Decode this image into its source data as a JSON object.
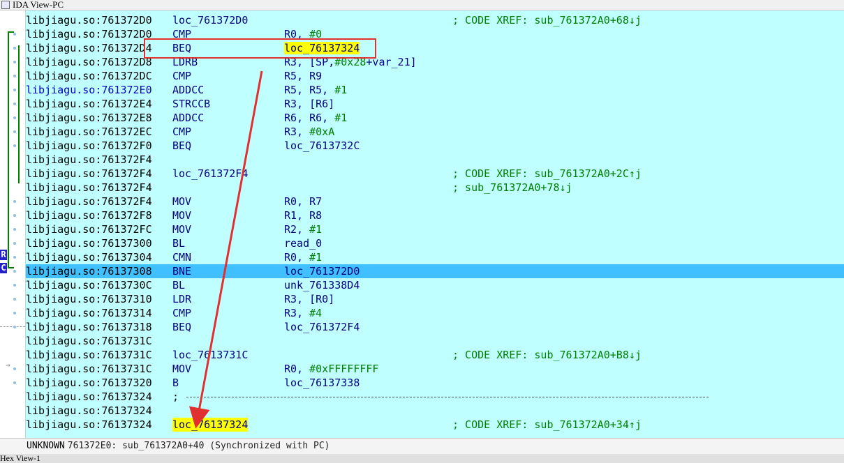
{
  "window": {
    "title": "IDA View-PC",
    "bottom_tab": "Hex View-1"
  },
  "gutter": {
    "pc_label_1": "R",
    "pc_label_2": "C"
  },
  "lines": [
    {
      "addr": "libjiagu.so:761372D0",
      "label": "loc_761372D0",
      "cmt": "; CODE XREF: sub_761372A0+68↓j"
    },
    {
      "addr": "libjiagu.so:761372D0",
      "mnem": "CMP",
      "ops": "R0, ",
      "num": "#0"
    },
    {
      "addr": "libjiagu.so:761372D4",
      "mnem": "BEQ",
      "ops": "",
      "target": "loc_76137324"
    },
    {
      "addr": "libjiagu.so:761372D8",
      "mnem": "LDRB",
      "ops": "R3, [SP,",
      "num": "#0x28",
      "ops2": "+var_21]"
    },
    {
      "addr": "libjiagu.so:761372DC",
      "mnem": "CMP",
      "ops": "R5, R9"
    },
    {
      "addr": "libjiagu.so:761372E0",
      "mnem": "ADDCC",
      "ops": "R5, R5, ",
      "num": "#1",
      "blue": true
    },
    {
      "addr": "libjiagu.so:761372E4",
      "mnem": "STRCCB",
      "ops": "R3, [R6]"
    },
    {
      "addr": "libjiagu.so:761372E8",
      "mnem": "ADDCC",
      "ops": "R6, R6, ",
      "num": "#1"
    },
    {
      "addr": "libjiagu.so:761372EC",
      "mnem": "CMP",
      "ops": "R3, ",
      "num": "#0xA"
    },
    {
      "addr": "libjiagu.so:761372F0",
      "mnem": "BEQ",
      "ops": "loc_7613732C"
    },
    {
      "addr": "libjiagu.so:761372F4"
    },
    {
      "addr": "libjiagu.so:761372F4",
      "label": "loc_761372F4",
      "cmt": "; CODE XREF: sub_761372A0+2C↑j"
    },
    {
      "addr": "libjiagu.so:761372F4",
      "cmt": "; sub_761372A0+78↓j"
    },
    {
      "addr": "libjiagu.so:761372F4",
      "mnem": "MOV",
      "ops": "R0, R7"
    },
    {
      "addr": "libjiagu.so:761372F8",
      "mnem": "MOV",
      "ops": "R1, R8"
    },
    {
      "addr": "libjiagu.so:761372FC",
      "mnem": "MOV",
      "ops": "R2, ",
      "num": "#1"
    },
    {
      "addr": "libjiagu.so:76137300",
      "mnem": "BL",
      "ops": "read_0"
    },
    {
      "addr": "libjiagu.so:76137304",
      "mnem": "CMN",
      "ops": "R0, ",
      "num": "#1"
    },
    {
      "addr": "libjiagu.so:76137308",
      "mnem": "BNE",
      "ops": "loc_761372D0",
      "highlight": true
    },
    {
      "addr": "libjiagu.so:7613730C",
      "mnem": "BL",
      "ops": "unk_761338D4"
    },
    {
      "addr": "libjiagu.so:76137310",
      "mnem": "LDR",
      "ops": "R3, [R0]"
    },
    {
      "addr": "libjiagu.so:76137314",
      "mnem": "CMP",
      "ops": "R3, ",
      "num": "#4"
    },
    {
      "addr": "libjiagu.so:76137318",
      "mnem": "BEQ",
      "ops": "loc_761372F4"
    },
    {
      "addr": "libjiagu.so:7613731C"
    },
    {
      "addr": "libjiagu.so:7613731C",
      "label": "loc_7613731C",
      "cmt": "; CODE XREF: sub_761372A0+B8↓j"
    },
    {
      "addr": "libjiagu.so:7613731C",
      "mnem": "MOV",
      "ops": "R0, ",
      "num": "#0xFFFFFFFF"
    },
    {
      "addr": "libjiagu.so:76137320",
      "mnem": "B",
      "ops": "loc_76137338"
    },
    {
      "addr": "libjiagu.so:76137324",
      "sep": ";"
    },
    {
      "addr": "libjiagu.so:76137324"
    },
    {
      "addr": "libjiagu.so:76137324",
      "label": "loc_76137324",
      "labelYellow": true,
      "cmt": "; CODE XREF: sub_761372A0+34↑j"
    }
  ],
  "status": {
    "mode": "UNKNOWN",
    "message": "761372E0: sub_761372A0+40 (Synchronized with PC)"
  },
  "colors": {
    "background": "#c0ffff",
    "highlight": "#40c0ff",
    "annotation": "#e03030",
    "mnemonic": "#000080",
    "comment": "#008000"
  }
}
